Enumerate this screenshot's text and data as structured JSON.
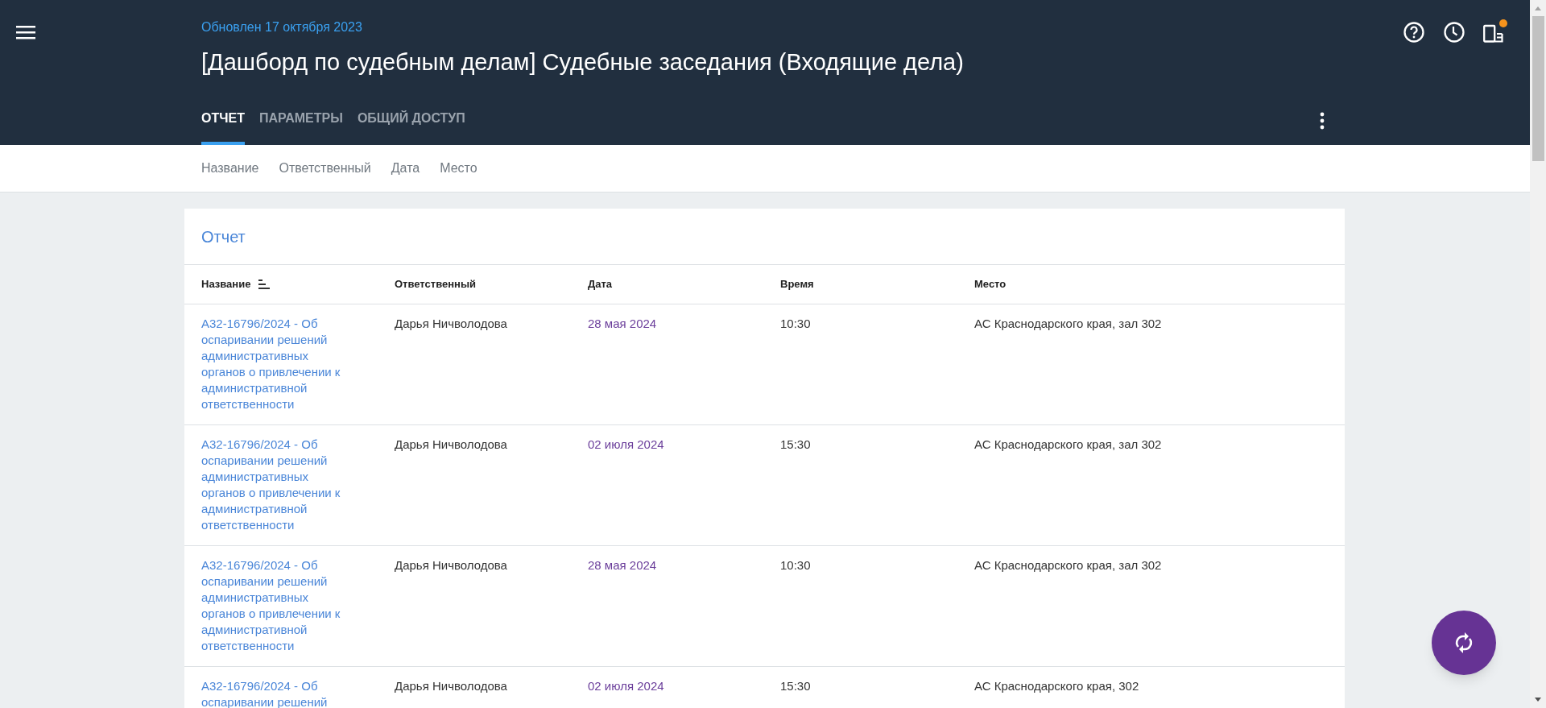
{
  "header": {
    "updated": "Обновлен 17 октября 2023",
    "title": "[Дашборд по судебным делам] Судебные заседания (Входящие дела)",
    "notification_dot": true
  },
  "tabs": [
    {
      "label": "ОТЧЕТ",
      "selected": true
    },
    {
      "label": "ПАРАМЕТРЫ",
      "selected": false
    },
    {
      "label": "ОБЩИЙ ДОСТУП",
      "selected": false
    }
  ],
  "filters": [
    "Название",
    "Ответственный",
    "Дата",
    "Место"
  ],
  "report": {
    "title": "Отчет",
    "columns": [
      {
        "label": "Название",
        "sorted": true
      },
      {
        "label": "Ответственный",
        "sorted": false
      },
      {
        "label": "Дата",
        "sorted": false
      },
      {
        "label": "Время",
        "sorted": false
      },
      {
        "label": "Место",
        "sorted": false
      }
    ],
    "rows": [
      {
        "name": "А32-16796/2024 - Об оспаривании решений административных органов о привлечении к административной ответственности",
        "responsible": "Дарья Ничволодова",
        "date": "28 мая 2024",
        "time": "10:30",
        "place": "АС Краснодарского края, зал 302"
      },
      {
        "name": "А32-16796/2024 - Об оспаривании решений административных органов о привлечении к административной ответственности",
        "responsible": "Дарья Ничволодова",
        "date": "02 июля 2024",
        "time": "15:30",
        "place": "АС Краснодарского края, зал 302"
      },
      {
        "name": "А32-16796/2024 - Об оспаривании решений административных органов о привлечении к административной ответственности",
        "responsible": "Дарья Ничволодова",
        "date": "28 мая 2024",
        "time": "10:30",
        "place": "АС Краснодарского края, зал 302"
      },
      {
        "name": "А32-16796/2024 - Об оспаривании решений",
        "responsible": "Дарья Ничволодова",
        "date": "02 июля 2024",
        "time": "15:30",
        "place": "АС Краснодарского края, 302"
      }
    ]
  }
}
